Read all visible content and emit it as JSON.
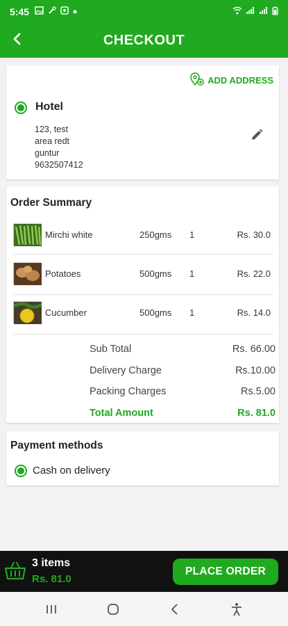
{
  "status_bar": {
    "time": "5:45",
    "icons": [
      "gallery-icon",
      "tool-icon",
      "app-icon",
      "dot-icon"
    ],
    "right_icons": [
      "wifi-icon",
      "signal-icon",
      "signal-icon",
      "battery-icon"
    ]
  },
  "header": {
    "title": "CHECKOUT",
    "back_icon": "arrow-left-icon"
  },
  "address": {
    "add_label": "ADD ADDRESS",
    "name": "Hotel",
    "lines": [
      "123, test",
      "area redt",
      "guntur",
      "9632507412"
    ],
    "selected": true
  },
  "order_summary": {
    "title": "Order Summary",
    "items": [
      {
        "name": "Mirchi white",
        "weight": "250gms",
        "qty": "1",
        "price": "Rs. 30.0"
      },
      {
        "name": "Potatoes",
        "weight": "500gms",
        "qty": "1",
        "price": "Rs. 22.0"
      },
      {
        "name": "Cucumber",
        "weight": "500gms",
        "qty": "1",
        "price": "Rs. 14.0"
      }
    ],
    "totals": [
      {
        "label": "Sub Total",
        "value": "Rs. 66.00"
      },
      {
        "label": "Delivery Charge",
        "value": "Rs.10.00"
      },
      {
        "label": "Packing Charges",
        "value": "Rs.5.00"
      },
      {
        "label": "Total Amount",
        "value": "Rs. 81.0"
      }
    ]
  },
  "payment": {
    "title": "Payment methods",
    "option": "Cash on delivery",
    "selected": true
  },
  "cart_bar": {
    "items_label": "3 items",
    "total": "Rs. 81.0",
    "button_label": "PLACE ORDER"
  },
  "colors": {
    "accent": "#1faa1f",
    "bar_dark": "#111111"
  }
}
